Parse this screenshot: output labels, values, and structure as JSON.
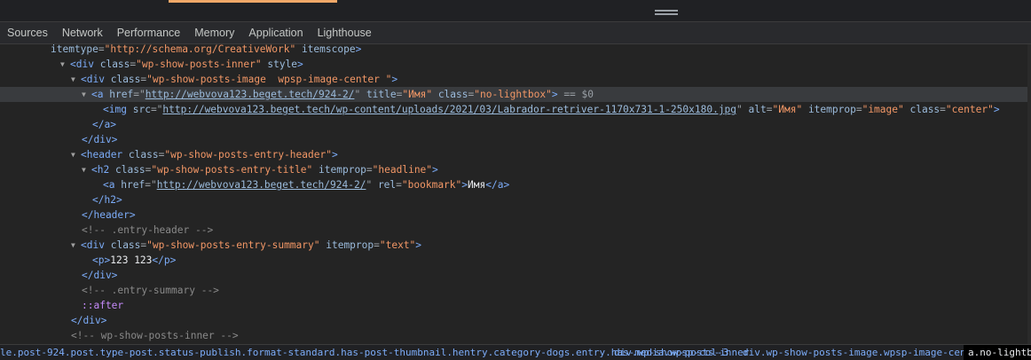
{
  "tabs": [
    "Sources",
    "Network",
    "Performance",
    "Memory",
    "Application",
    "Lighthouse"
  ],
  "dom": {
    "l1": {
      "a1": "itemtype",
      "v1": "\"http://schema.org/CreativeWork\"",
      "a2": "itemscope"
    },
    "l2": {
      "t": "div",
      "a1": "class",
      "v1": "\"wp-show-posts-inner\"",
      "a2": "style"
    },
    "l3": {
      "t": "div",
      "a1": "class",
      "v1": "\"wp-show-posts-image  wpsp-image-center \""
    },
    "l4": {
      "t": "a",
      "a1": "href",
      "v1": "http://webvova123.beget.tech/924-2/",
      "a2": "title",
      "v2": "\"Имя\"",
      "a3": "class",
      "v3": "\"no-lightbox\"",
      "sel": "== $0"
    },
    "l5": {
      "t": "img",
      "a1": "src",
      "v1": "http://webvova123.beget.tech/wp-content/uploads/2021/03/Labrador-retriver-1170x731-1-250x180.jpg",
      "a2": "alt",
      "v2": "\"Имя\"",
      "a3": "itemprop",
      "v3": "\"image\"",
      "a4": "class",
      "v4": "\"center\""
    },
    "l6": {
      "close": "</a>"
    },
    "l7": {
      "close": "</div>"
    },
    "l8": {
      "t": "header",
      "a1": "class",
      "v1": "\"wp-show-posts-entry-header\""
    },
    "l9": {
      "t": "h2",
      "a1": "class",
      "v1": "\"wp-show-posts-entry-title\"",
      "a2": "itemprop",
      "v2": "\"headline\""
    },
    "l10": {
      "t": "a",
      "a1": "href",
      "v1": "http://webvova123.beget.tech/924-2/",
      "a2": "rel",
      "v2": "\"bookmark\"",
      "text": "Имя",
      "close": "</a>"
    },
    "l11": {
      "close": "</h2>"
    },
    "l12": {
      "close": "</header>"
    },
    "l13": {
      "comment": "<!-- .entry-header -->"
    },
    "l14": {
      "t": "div",
      "a1": "class",
      "v1": "\"wp-show-posts-entry-summary\"",
      "a2": "itemprop",
      "v2": "\"text\""
    },
    "l15": {
      "t": "p",
      "text": "123 123",
      "close": "</p>"
    },
    "l16": {
      "close": "</div>"
    },
    "l17": {
      "comment": "<!-- .entry-summary -->"
    },
    "l18": {
      "pseudo": "::after"
    },
    "l19": {
      "close": "</div>"
    },
    "l20": {
      "comment": "<!-- wp-show-posts-inner -->"
    }
  },
  "breadcrumbs": [
    "le.post-924.post.type-post.status-publish.format-standard.has-post-thumbnail.hentry.category-dogs.entry.has-media.wpsp-col-3",
    "div.wp-show-posts-inner",
    "div.wp-show-posts-image.wpsp-image-center.",
    "a.no-lightbox"
  ],
  "colors": {
    "accent": "#f0a868",
    "tag": "#7cacf8",
    "attr_value": "#f29766",
    "selected_row": "#393b3e"
  }
}
